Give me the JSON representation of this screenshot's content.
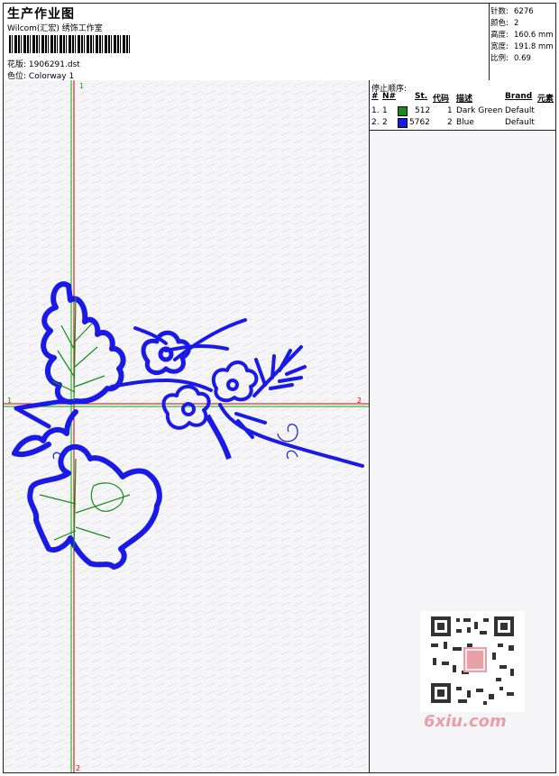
{
  "header": {
    "title": "生产作业图",
    "subtitle": "Wilcom(汇宏) 绣饰工作室",
    "design_label": "花版:",
    "design_value": "1906291.dst",
    "color_label": "色位:",
    "color_value": "Colorway 1"
  },
  "specs": [
    {
      "label": "针数:",
      "value": "6276"
    },
    {
      "label": "颜色:",
      "value": "2"
    },
    {
      "label": "高度:",
      "value": "160.6 mm"
    },
    {
      "label": "宽度:",
      "value": "191.8 mm"
    },
    {
      "label": "比例:",
      "value": "0.69"
    }
  ],
  "stops": {
    "title": "停止顺序:",
    "columns": [
      "#",
      "N#",
      "St.",
      "代码",
      "描述",
      "Brand",
      "元素"
    ],
    "rows": [
      {
        "num": "1.",
        "n": "1",
        "color": "#1a8a1a",
        "st": "512",
        "code": "1",
        "desc": "Dark Green",
        "brand": "Default"
      },
      {
        "num": "2.",
        "n": "2",
        "color": "#1a1ae6",
        "st": "5762",
        "code": "2",
        "desc": "Blue",
        "brand": "Default"
      }
    ]
  },
  "axes": {
    "v_top": "1",
    "v_bottom": "2",
    "h_left": "1",
    "h_right": "2"
  },
  "colors": {
    "stitch_blue": "#1a1ae6",
    "stitch_green": "#1a8a1a",
    "axis_red": "#d40000",
    "axis_green": "#00b000"
  },
  "watermark": "6xiu.com"
}
